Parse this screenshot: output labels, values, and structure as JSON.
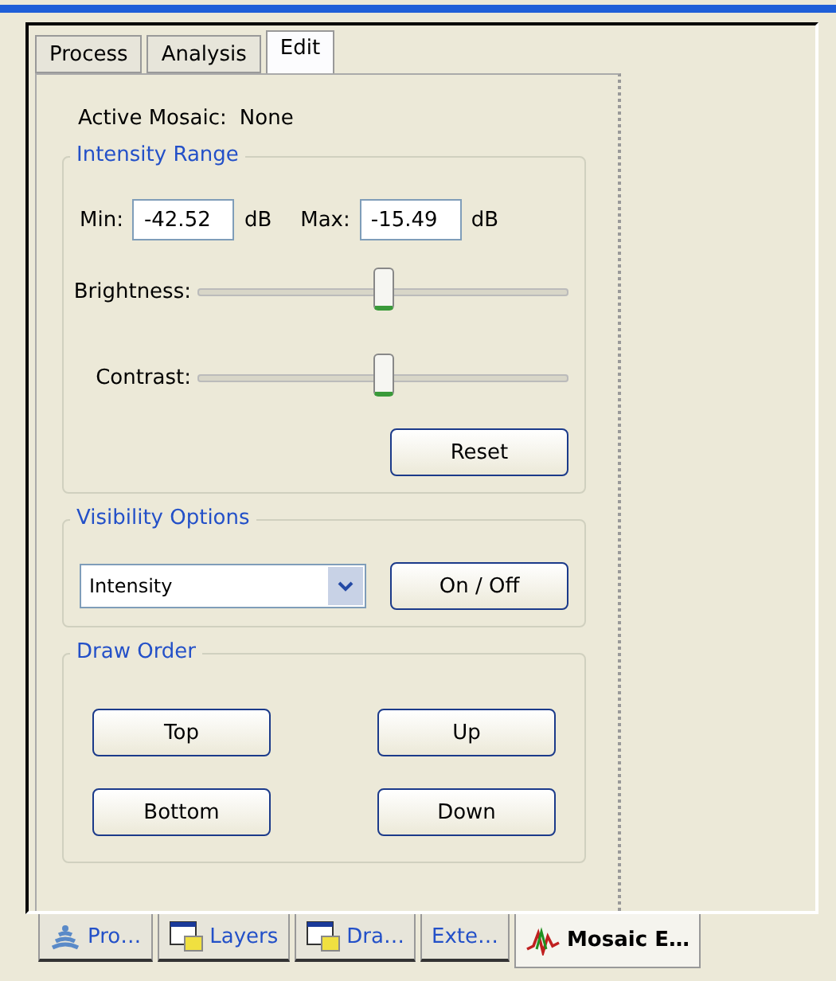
{
  "tabs": [
    {
      "label": "Process",
      "selected": false
    },
    {
      "label": "Analysis",
      "selected": false
    },
    {
      "label": "Edit",
      "selected": true
    }
  ],
  "active_mosaic": {
    "label": "Active Mosaic:",
    "value": "None"
  },
  "intensity_range": {
    "title": "Intensity Range",
    "min_label": "Min:",
    "min_value": "-42.52",
    "min_unit": "dB",
    "max_label": "Max:",
    "max_value": "-15.49",
    "max_unit": "dB",
    "sliders": [
      {
        "label": "Brightness:",
        "level": 0.5
      },
      {
        "label": "Contrast:",
        "level": 0.5
      }
    ],
    "reset": "Reset"
  },
  "visibility_options": {
    "title": "Visibility Options",
    "dropdown": "Intensity",
    "toggle": "On / Off"
  },
  "draw_order": {
    "title": "Draw Order",
    "buttons": [
      "Top",
      "Up",
      "Bottom",
      "Down"
    ]
  },
  "bottom_tabs": [
    {
      "label": "Pro…",
      "kind": "signal",
      "selected": false
    },
    {
      "label": "Layers",
      "kind": "window",
      "selected": false
    },
    {
      "label": "Dra…",
      "kind": "window",
      "selected": false
    },
    {
      "label": "Exte…",
      "kind": "plain",
      "selected": false
    },
    {
      "label": "Mosaic E…",
      "kind": "chart",
      "selected": true
    }
  ]
}
